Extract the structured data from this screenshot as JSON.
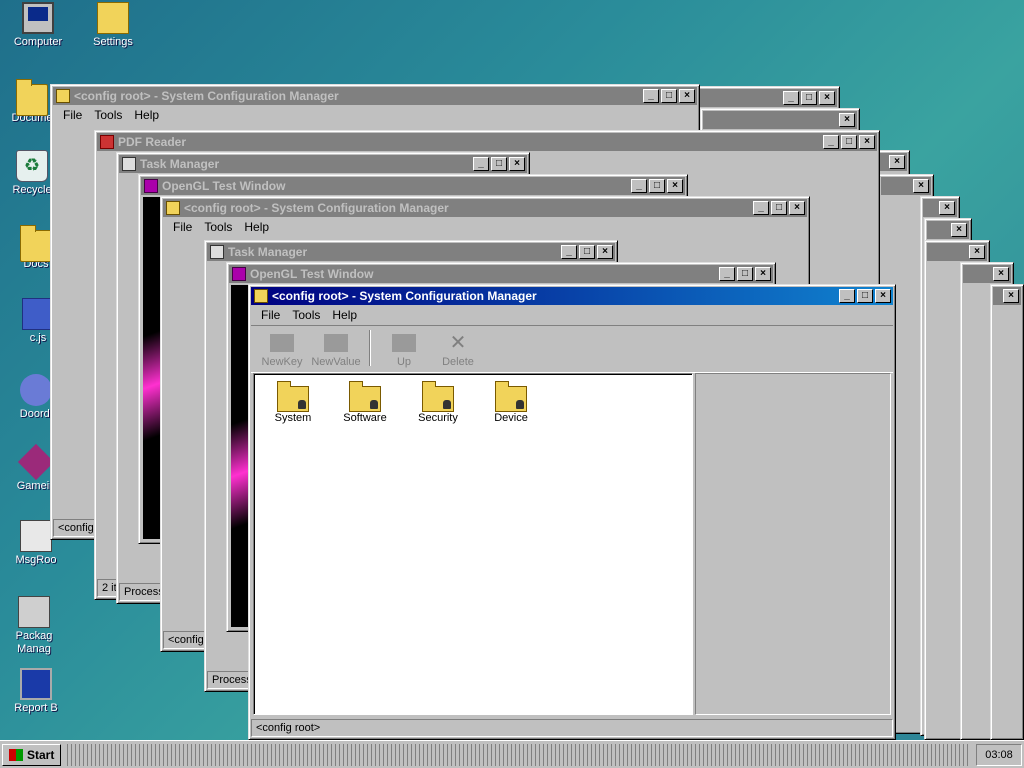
{
  "desktop": {
    "icons": [
      {
        "label": "Computer",
        "icon": "computer-icon"
      },
      {
        "label": "Settings",
        "icon": "settings-icon"
      },
      {
        "label": "Docume",
        "icon": "folder-icon"
      },
      {
        "label": "Recycle",
        "icon": "recycle-bin-icon"
      },
      {
        "label": "Docs",
        "icon": "folder-icon"
      },
      {
        "label": "c.js",
        "icon": "script-icon"
      },
      {
        "label": "Doordi",
        "icon": "discord-icon"
      },
      {
        "label": "Gamein",
        "icon": "game-icon"
      },
      {
        "label": "MsgRoo",
        "icon": "message-icon"
      },
      {
        "label": "Packag Manag",
        "icon": "package-icon"
      },
      {
        "label": "Report B",
        "icon": "report-icon"
      }
    ]
  },
  "background_windows": [
    {
      "title": "<config root> - System Configuration Manager",
      "menu": [
        "File",
        "Tools",
        "Help"
      ],
      "status": "<config"
    },
    {
      "title": "PDF Reader",
      "status": "2 ite"
    },
    {
      "title": "Task Manager",
      "status": "Process"
    },
    {
      "title": "OpenGL Test Window"
    },
    {
      "title": "<config root> - System Configuration Manager",
      "menu": [
        "File",
        "Tools",
        "Help"
      ],
      "status": "<config"
    },
    {
      "title": "Task Manager",
      "status": "Process"
    },
    {
      "title": "OpenGL Test Window"
    }
  ],
  "main_window": {
    "title": "<config root> - System Configuration Manager",
    "menu": [
      "File",
      "Tools",
      "Help"
    ],
    "toolbar": [
      "NewKey",
      "NewValue",
      "Up",
      "Delete"
    ],
    "folders": [
      "System",
      "Software",
      "Security",
      "Device"
    ],
    "status": "<config root>"
  },
  "taskbar": {
    "start_label": "Start",
    "clock": "03:08"
  },
  "colors": {
    "active_title_start": "#000080",
    "active_title_end": "#1084d0",
    "inactive_title": "#808080",
    "window_face": "#c0c0c0"
  }
}
